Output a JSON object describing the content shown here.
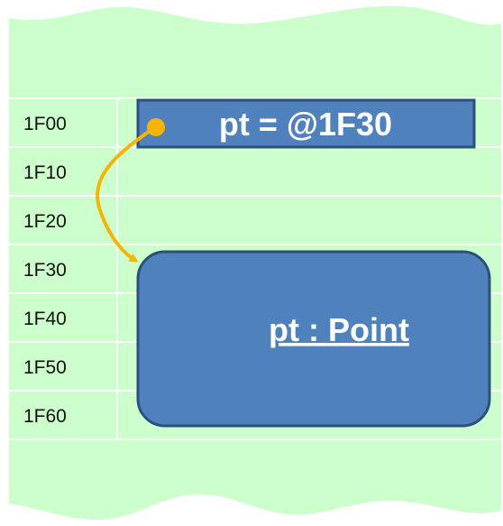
{
  "memory": {
    "addresses": [
      "1F00",
      "1F10",
      "1F20",
      "1F30",
      "1F40",
      "1F50",
      "1F60"
    ]
  },
  "pointer": {
    "label": "pt = @1F30"
  },
  "object": {
    "label": "pt : Point"
  },
  "colors": {
    "memory_background": "#ccffcc",
    "grid_lines": "#ffffff",
    "box_fill": "#4f81bd",
    "box_border": "#2c4f7c",
    "arrow": "#f5b400",
    "text_dark": "#111111",
    "text_light": "#ffffff"
  }
}
